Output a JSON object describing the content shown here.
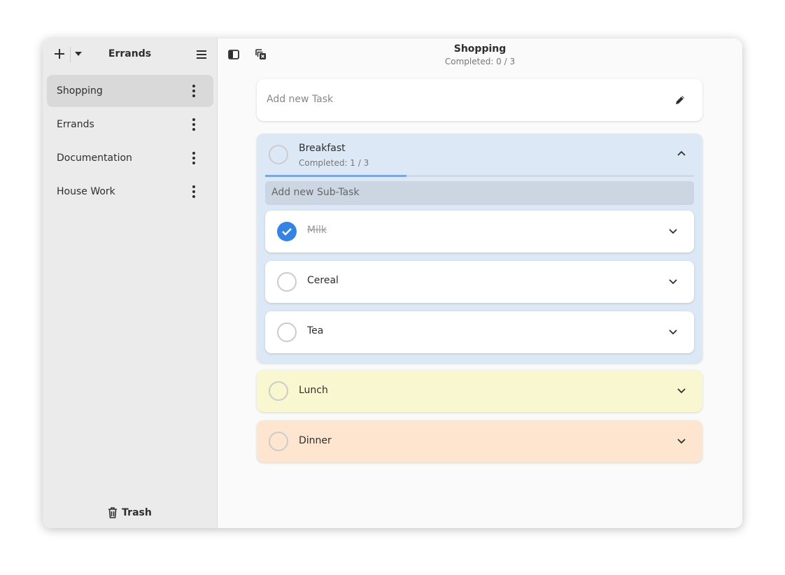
{
  "sidebar": {
    "title": "Errands",
    "items": [
      {
        "label": "Shopping"
      },
      {
        "label": "Errands"
      },
      {
        "label": "Documentation"
      },
      {
        "label": "House Work"
      }
    ],
    "trash_label": "Trash"
  },
  "header": {
    "title": "Shopping",
    "subtitle": "Completed: 0 / 3"
  },
  "main": {
    "new_task_placeholder": "Add new Task",
    "tasks": [
      {
        "title": "Breakfast",
        "subtitle": "Completed: 1 / 3",
        "progress": 0.33,
        "color": "#dde8f6",
        "subtask_placeholder": "Add new Sub-Task",
        "subtasks": [
          {
            "title": "Milk",
            "done": true
          },
          {
            "title": "Cereal",
            "done": false
          },
          {
            "title": "Tea",
            "done": false
          }
        ]
      },
      {
        "title": "Lunch",
        "color": "#f9f7d0"
      },
      {
        "title": "Dinner",
        "color": "#fde5cf"
      }
    ]
  },
  "colors": {
    "accent": "#3584e4"
  }
}
